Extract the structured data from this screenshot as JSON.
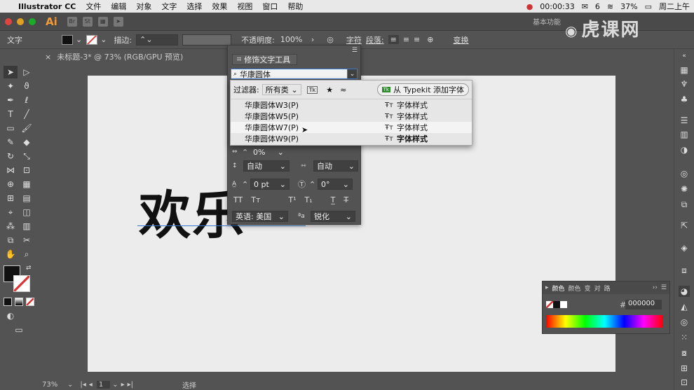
{
  "menubar": {
    "app_name": "Illustrator CC",
    "items": [
      "文件",
      "编辑",
      "对象",
      "文字",
      "选择",
      "效果",
      "视图",
      "窗口",
      "帮助"
    ],
    "timer": "00:00:33",
    "wechat_count": "6",
    "battery": "37%",
    "clock": "周二上午"
  },
  "appbar": {
    "logo": "Ai",
    "workspace": "基本功能"
  },
  "control": {
    "context_label": "文字",
    "stroke_label": "描边:",
    "opacity_label": "不透明度:",
    "opacity_value": "100%",
    "char_label": "字符",
    "para_label": "段落:",
    "transform_label": "变换"
  },
  "document": {
    "tab_title": "未标题-3* @ 73% (RGB/GPU 预览)",
    "art_text": "欢乐"
  },
  "char_panel": {
    "touch_tool_label": "修饰文字工具",
    "search_value": "华康圆体",
    "tracking": "0%",
    "leading": "自动",
    "kerning": "自动",
    "baseline_shift": "0 pt",
    "rotation": "0°",
    "language": "英语: 美国",
    "antialias": "锐化"
  },
  "font_dropdown": {
    "filter_label": "过滤器:",
    "filter_value": "所有类",
    "typekit_label": "从 Typekit 添加字体",
    "fonts": [
      {
        "name": "华康圆体W3(P)",
        "sample": "字体样式"
      },
      {
        "name": "华康圆体W5(P)",
        "sample": "字体样式"
      },
      {
        "name": "华康圆体W7(P)",
        "sample": "字体样式"
      },
      {
        "name": "华康圆体W9(P)",
        "sample": "字体样式"
      }
    ]
  },
  "color_panel": {
    "tabs": [
      "颜色",
      "颜色",
      "变",
      "对",
      "路"
    ],
    "hex_label": "#",
    "hex_value": "000000"
  },
  "status": {
    "zoom": "73%",
    "artboard_num": "1",
    "tool_name": "选择"
  },
  "watermark": "虎课网",
  "colors": {
    "accent_blue": "#3a78c8",
    "ai_orange": "#f29a38"
  }
}
